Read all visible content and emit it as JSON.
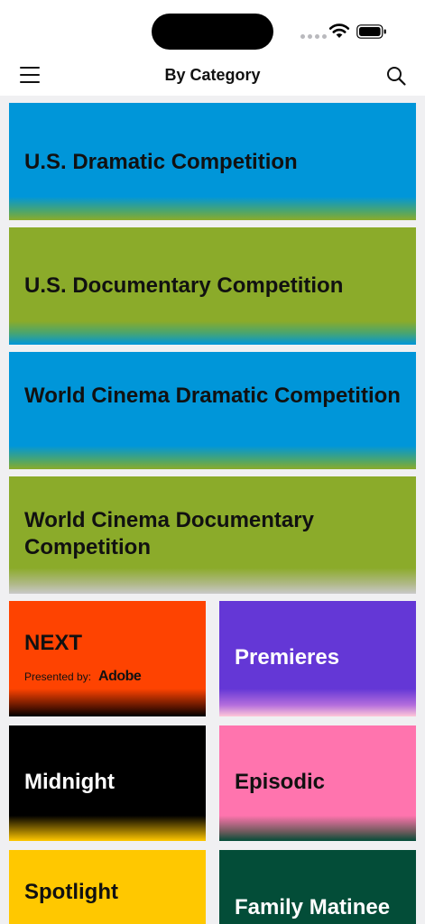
{
  "nav": {
    "title": "By Category"
  },
  "categories": [
    {
      "label": "U.S. Dramatic Competition",
      "color": "#0096d9"
    },
    {
      "label": "U.S. Documentary Competition",
      "color": "#8bab2a"
    },
    {
      "label": "World Cinema Dramatic Competition",
      "color": "#0096d9"
    },
    {
      "label": "World Cinema Documentary Competition",
      "color": "#8bab2a"
    },
    {
      "label": "NEXT",
      "color": "#fe4301",
      "sponsor_text": "Presented by:",
      "sponsor_brand": "Adobe"
    },
    {
      "label": "Premieres",
      "color": "#6437d6"
    },
    {
      "label": "Midnight",
      "color": "#000000"
    },
    {
      "label": "Episodic",
      "color": "#ff74ae"
    },
    {
      "label": "Spotlight",
      "color": "#ffc800"
    },
    {
      "label": "Family Matinee",
      "color": "#034d38"
    }
  ]
}
